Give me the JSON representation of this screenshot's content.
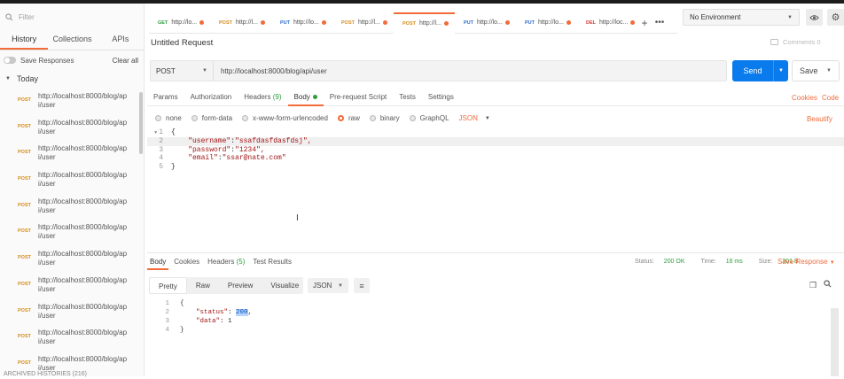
{
  "sidebar": {
    "filter_placeholder": "Filter",
    "tabs": [
      {
        "label": "History",
        "active": true
      },
      {
        "label": "Collections",
        "active": false
      },
      {
        "label": "APIs",
        "active": false
      }
    ],
    "save_responses_label": "Save Responses",
    "clear_all_label": "Clear all",
    "group_label": "Today",
    "items": [
      {
        "method": "POST",
        "url": "http://localhost:8000/blog/api/user"
      },
      {
        "method": "POST",
        "url": "http://localhost:8000/blog/api/user"
      },
      {
        "method": "POST",
        "url": "http://localhost:8000/blog/api/user"
      },
      {
        "method": "POST",
        "url": "http://localhost:8000/blog/api/user"
      },
      {
        "method": "POST",
        "url": "http://localhost:8000/blog/api/user"
      },
      {
        "method": "POST",
        "url": "http://localhost:8000/blog/api/user"
      },
      {
        "method": "POST",
        "url": "http://localhost:8000/blog/api/user"
      },
      {
        "method": "POST",
        "url": "http://localhost:8000/blog/api/user"
      },
      {
        "method": "POST",
        "url": "http://localhost:8000/blog/api/user"
      },
      {
        "method": "POST",
        "url": "http://localhost:8000/blog/api/user"
      },
      {
        "method": "POST",
        "url": "http://localhost:8000/blog/api/user"
      }
    ],
    "archived_label": "ARCHIVED HISTORIES (216)"
  },
  "tabs": [
    {
      "method": "GET",
      "label": "http://lo...",
      "active": false
    },
    {
      "method": "POST",
      "label": "http://l...",
      "active": false
    },
    {
      "method": "PUT",
      "label": "http://lo...",
      "active": false
    },
    {
      "method": "POST",
      "label": "http://l...",
      "active": false
    },
    {
      "method": "POST",
      "label": "http://l...",
      "active": true
    },
    {
      "method": "PUT",
      "label": "http://lo...",
      "active": false
    },
    {
      "method": "PUT",
      "label": "http://lo...",
      "active": false
    },
    {
      "method": "DEL",
      "label": "http://loc...",
      "active": false
    }
  ],
  "environment": {
    "selected": "No Environment"
  },
  "request": {
    "title": "Untitled Request",
    "comments_label": "Comments 0",
    "method": "POST",
    "url": "http://localhost:8000/blog/api/user",
    "send_label": "Send",
    "save_label": "Save",
    "subtabs": {
      "params": "Params",
      "authorization": "Authorization",
      "headers": "Headers",
      "headers_count": "(9)",
      "body": "Body",
      "prerequest": "Pre-request Script",
      "tests": "Tests",
      "settings": "Settings"
    },
    "cookies_label": "Cookies",
    "code_label": "Code",
    "body_options": {
      "none": "none",
      "form_data": "form-data",
      "urlencoded": "x-www-form-urlencoded",
      "raw": "raw",
      "binary": "binary",
      "graphql": "GraphQL",
      "format": "JSON",
      "selected": "raw"
    },
    "beautify_label": "Beautify",
    "body_lines": [
      {
        "no": "1",
        "text": "{"
      },
      {
        "no": "2",
        "key": "\"username\"",
        "value": "\"ssafdasfdasfdsj\","
      },
      {
        "no": "3",
        "key": "\"password\"",
        "value": "\"1234\","
      },
      {
        "no": "4",
        "key": "\"email\"",
        "value": "\"ssar@nate.com\""
      },
      {
        "no": "5",
        "text": "}"
      }
    ]
  },
  "response": {
    "tabs": {
      "body": "Body",
      "cookies": "Cookies",
      "headers": "Headers",
      "headers_count": "(5)",
      "test_results": "Test Results"
    },
    "status_label": "Status:",
    "status_value": "200 OK",
    "time_label": "Time:",
    "time_value": "16 ms",
    "size_label": "Size:",
    "size_value": "201 B",
    "save_response_label": "Save Response",
    "view_modes": {
      "pretty": "Pretty",
      "raw": "Raw",
      "preview": "Preview",
      "visualize": "Visualize"
    },
    "format": "JSON",
    "lines": [
      {
        "no": "1",
        "text": "{"
      },
      {
        "no": "2",
        "key": "\"status\"",
        "value": "200"
      },
      {
        "no": "3",
        "key": "\"data\"",
        "value": "1"
      },
      {
        "no": "4",
        "text": "}"
      }
    ]
  },
  "colors": {
    "accent": "#f26b3a",
    "send": "#097bed",
    "post": "#d68c1a",
    "get": "#2d9e3e",
    "put": "#2a6bd0",
    "delete": "#d13b3b"
  }
}
